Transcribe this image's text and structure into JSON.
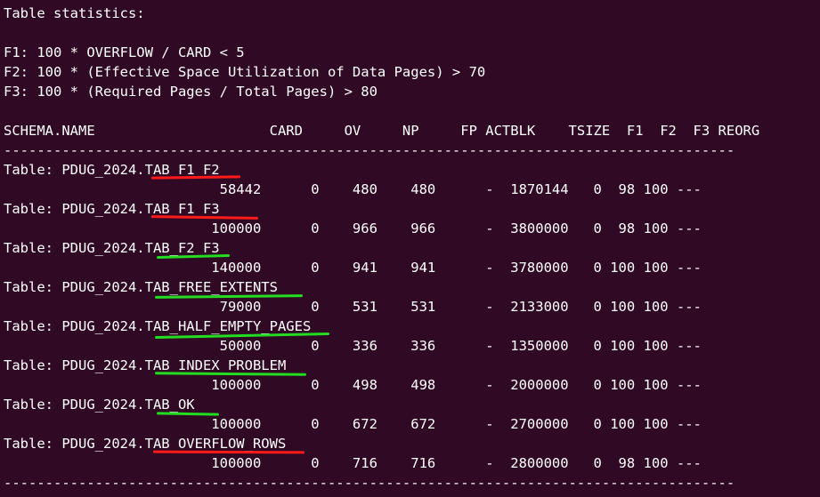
{
  "terminal": {
    "heading": "Table statistics:",
    "formula_f1": "F1: 100 * OVERFLOW / CARD < 5",
    "formula_f2": "F2: 100 * (Effective Space Utilization of Data Pages) > 70",
    "formula_f3": "F3: 100 * (Required Pages / Total Pages) > 80",
    "column_header": "SCHEMA.NAME                     CARD     OV     NP     FP ACTBLK    TSIZE  F1  F2  F3 REORG",
    "separator": "----------------------------------------------------------------------------------------",
    "tables": [
      {
        "name": "Table: PDUG_2024.TAB_F1_F2",
        "stats": "                          58442      0    480    480      -  1870144   0  98 100 ---"
      },
      {
        "name": "Table: PDUG_2024.TAB_F1_F3",
        "stats": "                         100000      0    966    966      -  3800000   0  98 100 ---"
      },
      {
        "name": "Table: PDUG_2024.TAB_F2_F3",
        "stats": "                         140000      0    941    941      -  3780000   0 100 100 ---"
      },
      {
        "name": "Table: PDUG_2024.TAB_FREE_EXTENTS",
        "stats": "                          79000      0    531    531      -  2133000   0 100 100 ---"
      },
      {
        "name": "Table: PDUG_2024.TAB_HALF_EMPTY_PAGES",
        "stats": "                          50000      0    336    336      -  1350000   0 100 100 ---"
      },
      {
        "name": "Table: PDUG_2024.TAB_INDEX_PROBLEM",
        "stats": "                         100000      0    498    498      -  2000000   0 100 100 ---"
      },
      {
        "name": "Table: PDUG_2024.TAB_OK",
        "stats": "                         100000      0    672    672      -  2700000   0 100 100 ---"
      },
      {
        "name": "Table: PDUG_2024.TAB_OVERFLOW_ROWS",
        "stats": "                         100000      0    716    716      -  2800000   0  98 100 ---"
      }
    ]
  },
  "annotation_colors": {
    "red": "#ff1a1a",
    "green": "#22dd22"
  }
}
